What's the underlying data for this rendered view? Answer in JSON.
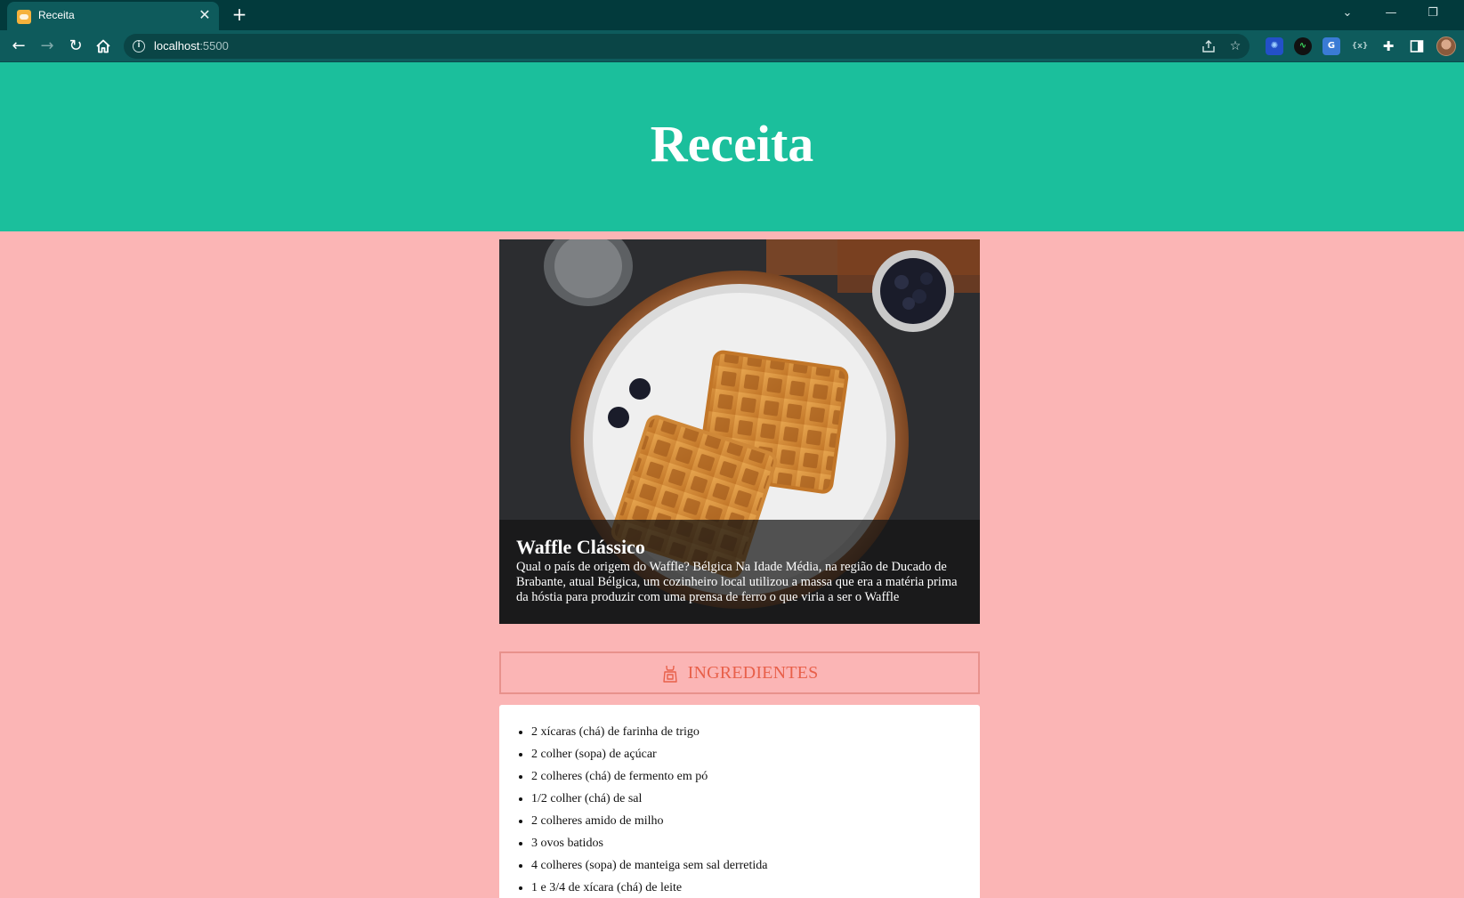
{
  "browser": {
    "tab_title": "Receita",
    "tab_close": "✕",
    "new_tab": "+",
    "url_host": "localhost",
    "url_port": ":5500",
    "window_controls": {
      "tab_search": "⌄",
      "minimize": "—",
      "restore": "❐"
    }
  },
  "page": {
    "title": "Receita",
    "recipe": {
      "name": "Waffle Clássico",
      "description": "Qual o país de origem do Waffle? Bélgica Na Idade Média, na região de Ducado de Brabante, atual Bélgica, um cozinheiro local utilizou a massa que era a matéria prima da hóstia para produzir com uma prensa de ferro o que viria a ser o Waffle"
    },
    "ingredients": {
      "heading": "INGREDIENTES",
      "items": [
        "2 xícaras (chá) de farinha de trigo",
        "2 colher (sopa) de açúcar",
        "2 colheres (chá) de fermento em pó",
        "1/2 colher (chá) de sal",
        "2 colheres amido de milho",
        "3 ovos batidos",
        "4 colheres (sopa) de manteiga sem sal derretida",
        "1 e 3/4 de xícara (chá) de leite"
      ]
    }
  },
  "colors": {
    "hero": "#1bbf9c",
    "background": "#fbb5b5",
    "accent": "#e8604a",
    "chrome_dark": "#023a3c",
    "chrome_toolbar": "#0e5b5c"
  }
}
